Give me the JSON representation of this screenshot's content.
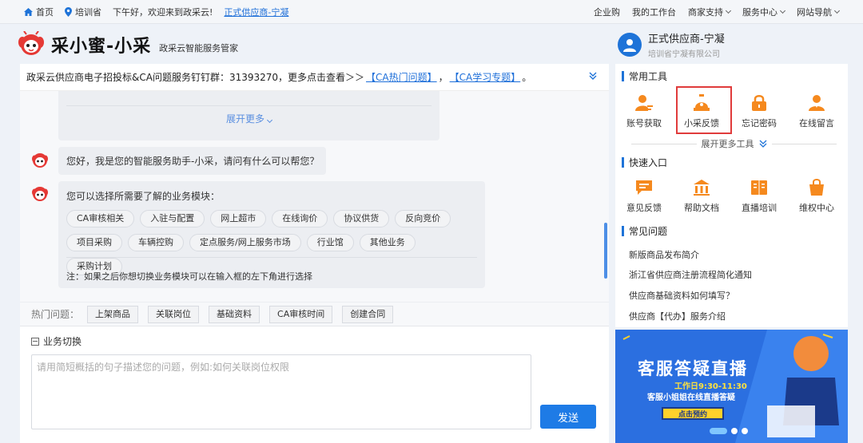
{
  "topbar": {
    "home": "首页",
    "region": "培训省",
    "greeting": "下午好，欢迎来到政采云!",
    "supplier_link": "正式供应商-宁凝",
    "right_items": [
      "企业购",
      "我的工作台",
      "商家支持",
      "服务中心",
      "网站导航"
    ]
  },
  "brand": {
    "title": "采小蜜-小采",
    "subtitle": "政采云智能服务管家"
  },
  "user": {
    "name": "正式供应商-宁凝",
    "company": "培训省宁凝有限公司"
  },
  "notice": {
    "text": "政采云供应商电子招投标&CA问题服务钉钉群：31393270，更多点击查看＞＞",
    "link1": "【CA热门问题】",
    "sep": "，",
    "link2": "【CA学习专题】",
    "end": "。"
  },
  "chat": {
    "previous_more": "展开更多",
    "greeting": "您好，我是您的智能服务助手-小采，请问有什么可以帮您？",
    "module_prompt": "您可以选择所需要了解的业务模块：",
    "modules": [
      "CA审核相关",
      "入驻与配置",
      "网上超市",
      "在线询价",
      "协议供货",
      "反向竞价",
      "项目采购",
      "车辆控购",
      "定点服务/网上服务市场",
      "行业馆",
      "其他业务",
      "采购计划"
    ],
    "note": "注：如果之后你想切换业务模块可以在输入框的左下角进行选择"
  },
  "hot": {
    "label": "热门问题：",
    "tags": [
      "上架商品",
      "关联岗位",
      "基础资料",
      "CA审核时间",
      "创建合同"
    ]
  },
  "input": {
    "switch_label": "业务切换",
    "placeholder": "请用简短概括的句子描述您的问题，例如:如何关联岗位权限",
    "send": "发送"
  },
  "tools": {
    "title": "常用工具",
    "items": [
      {
        "label": "账号获取",
        "icon": "user-key-icon"
      },
      {
        "label": "小采反馈",
        "icon": "alarm-icon"
      },
      {
        "label": "忘记密码",
        "icon": "lock-icon"
      },
      {
        "label": "在线留言",
        "icon": "person-icon"
      }
    ],
    "expand": "展开更多工具"
  },
  "quick": {
    "title": "快速入口",
    "items": [
      {
        "label": "意见反馈",
        "icon": "feedback-icon"
      },
      {
        "label": "帮助文档",
        "icon": "bank-icon"
      },
      {
        "label": "直播培训",
        "icon": "book-icon"
      },
      {
        "label": "维权中心",
        "icon": "bag-icon"
      }
    ]
  },
  "faq": {
    "title": "常见问题",
    "items": [
      "新版商品发布简介",
      "浙江省供应商注册流程简化通知",
      "供应商基础资料如何填写？",
      "供应商【代办】服务介绍"
    ]
  },
  "banner": {
    "title": "客服答疑直播",
    "time": "工作日9:30-11:30",
    "desc": "客服小姐姐在线直播答疑",
    "cta": "点击预约"
  },
  "colors": {
    "primary": "#1e73d8",
    "highlight": "#e03b3b",
    "orange": "#f5891e"
  }
}
